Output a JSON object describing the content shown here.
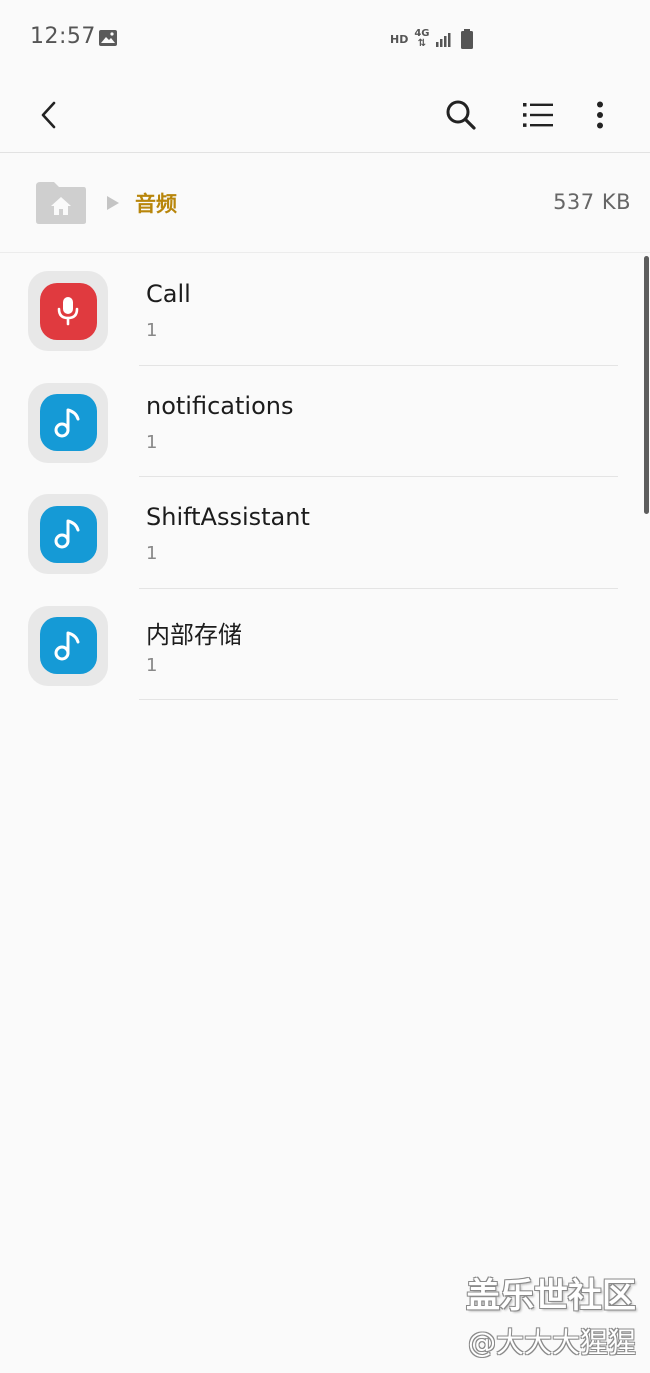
{
  "status_bar": {
    "time": "12:57",
    "hd": "HD",
    "network": "4G",
    "gallery_icon": "image-icon",
    "signal_icon": "signal-bars-icon",
    "battery_icon": "battery-icon"
  },
  "toolbar": {
    "back_icon": "chevron-left-icon",
    "search_icon": "search-icon",
    "list_view_icon": "list-view-icon",
    "more_icon": "more-vertical-icon"
  },
  "breadcrumb": {
    "home_icon": "home-folder-icon",
    "current": "音频",
    "size": "537 KB"
  },
  "colors": {
    "accent": "#b8860b",
    "red_badge": "#e03a3f",
    "blue_badge": "#159ad6"
  },
  "files": [
    {
      "name": "Call",
      "count": "1",
      "icon": "microphone-icon"
    },
    {
      "name": "notifications",
      "count": "1",
      "icon": "music-note-icon"
    },
    {
      "name": "ShiftAssistant",
      "count": "1",
      "icon": "music-note-icon"
    },
    {
      "name": "内部存储",
      "count": "1",
      "icon": "music-note-icon"
    }
  ],
  "watermark": {
    "title": "盖乐世社区",
    "subtitle": "@大大大猩猩"
  }
}
